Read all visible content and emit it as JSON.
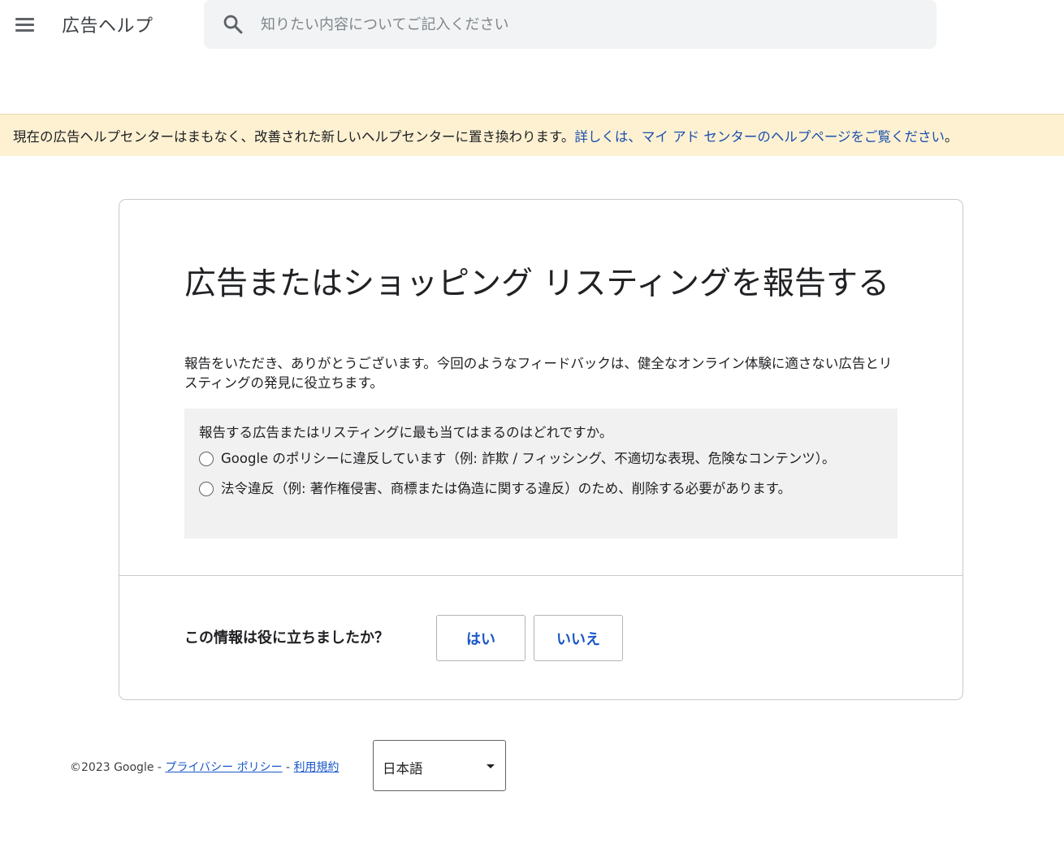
{
  "header": {
    "menu_icon": "hamburger-menu-icon",
    "product_name": "広告ヘルプ",
    "search": {
      "icon": "search-icon",
      "placeholder": "知りたい内容についてご記入ください",
      "value": ""
    }
  },
  "banner": {
    "text": "現在の広告ヘルプセンターはまもなく、改善された新しいヘルプセンターに置き換わります。",
    "link_text": "詳しくは、マイ アド センターのヘルプページをご覧ください",
    "trailing": "。",
    "bg_color": "#fdf1d2",
    "link_color": "#1a4fad"
  },
  "article": {
    "title": "広告またはショッピング リスティングを報告する",
    "description": "報告をいただき、ありがとうございます。今回のようなフィードバックは、健全なオンライン体験に適さない広告とリスティングの発見に役立ちます。",
    "report_form": {
      "question": "報告する広告またはリスティングに最も当てはまるのはどれですか。",
      "options": [
        {
          "label": "Google のポリシーに違反しています（例: 詐欺 / フィッシング、不適切な表現、危険なコンテンツ）。",
          "selected": false
        },
        {
          "label": "法令違反（例: 著作権侵害、商標または偽造に関する違反）のため、削除する必要があります。",
          "selected": false
        }
      ]
    }
  },
  "feedback": {
    "question": "この情報は役に立ちましたか？",
    "yes_label": "はい",
    "no_label": "いいえ",
    "button_text_color": "#1a57c7"
  },
  "footer": {
    "copyright": "©2023 Google - ",
    "privacy_link": "プライバシー ポリシー",
    "separator": " - ",
    "terms_link": "利用規約",
    "language": {
      "selected": "日本語",
      "icon": "dropdown-caret-icon"
    }
  }
}
